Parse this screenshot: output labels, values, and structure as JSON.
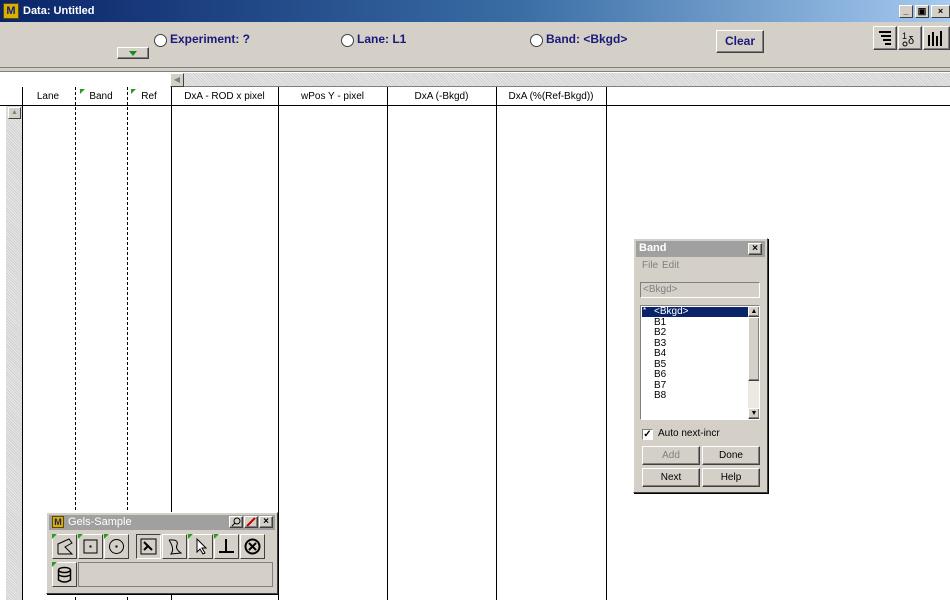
{
  "window": {
    "title": "Data: Untitled",
    "app_letter": "M",
    "controls": [
      "_",
      "▣",
      "×"
    ]
  },
  "toolbar": {
    "experiment": "Experiment: ?",
    "lane": "Lane: L1",
    "band": "Band: <Bkgd>",
    "clear": "Clear"
  },
  "table": {
    "columns": [
      "Lane",
      "Band",
      "Ref",
      "DxA - ROD x pixel",
      "wPos Y - pixel",
      "DxA  (-Bkgd)",
      "DxA  (%(Ref-Bkgd))"
    ]
  },
  "band_window": {
    "title": "Band",
    "menu": [
      "File",
      "Edit"
    ],
    "field": "<Bkgd>",
    "items": [
      "<Bkgd>",
      "B1",
      "B2",
      "B3",
      "B4",
      "B5",
      "B6",
      "B7",
      "B8"
    ],
    "selected_index": 0,
    "auto_label": "Auto next-incr",
    "auto_checked": true,
    "buttons": {
      "add": "Add",
      "done": "Done",
      "next": "Next",
      "help": "Help"
    }
  },
  "gels_window": {
    "title": "Gels-Sample",
    "app_letter": "M",
    "tools": [
      "polygon-tool",
      "rectangle-tool",
      "ellipse-tool",
      "auto-select-tool",
      "freehand-tool",
      "pointer-tool",
      "line-tool",
      "clear-tool",
      "database-tool"
    ]
  },
  "colors": {
    "titlebar_dark": "#0a246a",
    "titlebar_light": "#a6caf0",
    "label_blue": "#1a1a7a",
    "selection": "#0a246a",
    "accent_green": "#2a9a2a"
  }
}
